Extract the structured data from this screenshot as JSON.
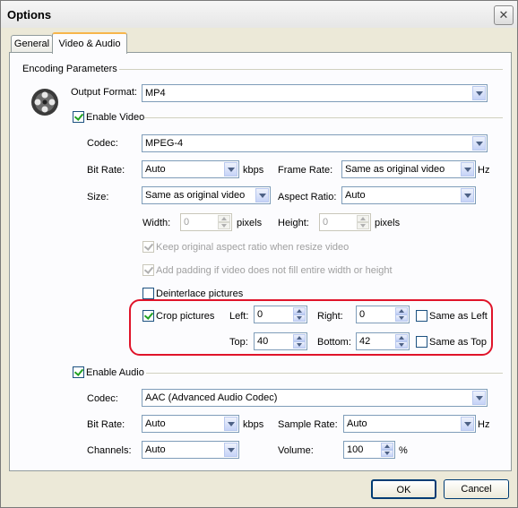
{
  "window": {
    "title": "Options",
    "close": "✕"
  },
  "tabs": {
    "general": "General",
    "video_audio": "Video & Audio"
  },
  "encoding": {
    "header": "Encoding Parameters",
    "output_format_label": "Output Format:",
    "output_format": "MP4"
  },
  "video": {
    "enable_label": "Enable Video",
    "codec_label": "Codec:",
    "codec": "MPEG-4",
    "bitrate_label": "Bit Rate:",
    "bitrate": "Auto",
    "bitrate_unit": "kbps",
    "framerate_label": "Frame Rate:",
    "framerate": "Same as original video",
    "framerate_unit": "Hz",
    "size_label": "Size:",
    "size": "Same as original video",
    "aspect_label": "Aspect Ratio:",
    "aspect": "Auto",
    "width_label": "Width:",
    "width": "0",
    "width_unit": "pixels",
    "height_label": "Height:",
    "height": "0",
    "height_unit": "pixels",
    "keep_aspect": "Keep original aspect ratio when resize video",
    "add_padding": "Add padding if video does not fill entire width or height",
    "deinterlace": "Deinterlace pictures"
  },
  "crop": {
    "label": "Crop pictures",
    "left_label": "Left:",
    "left": "0",
    "right_label": "Right:",
    "right": "0",
    "top_label": "Top:",
    "top": "40",
    "bottom_label": "Bottom:",
    "bottom": "42",
    "same_left": "Same as Left",
    "same_top": "Same as Top"
  },
  "audio": {
    "enable_label": "Enable Audio",
    "codec_label": "Codec:",
    "codec": "AAC (Advanced Audio Codec)",
    "bitrate_label": "Bit Rate:",
    "bitrate": "Auto",
    "bitrate_unit": "kbps",
    "samplerate_label": "Sample Rate:",
    "samplerate": "Auto",
    "samplerate_unit": "Hz",
    "channels_label": "Channels:",
    "channels": "Auto",
    "volume_label": "Volume:",
    "volume": "100",
    "volume_unit": "%"
  },
  "buttons": {
    "ok": "OK",
    "cancel": "Cancel"
  },
  "colors": {
    "highlight_outline": "#e0142a",
    "tab_accent": "#f7b64b"
  },
  "icons": {
    "media": "film-reel-icon",
    "close": "close-icon"
  }
}
